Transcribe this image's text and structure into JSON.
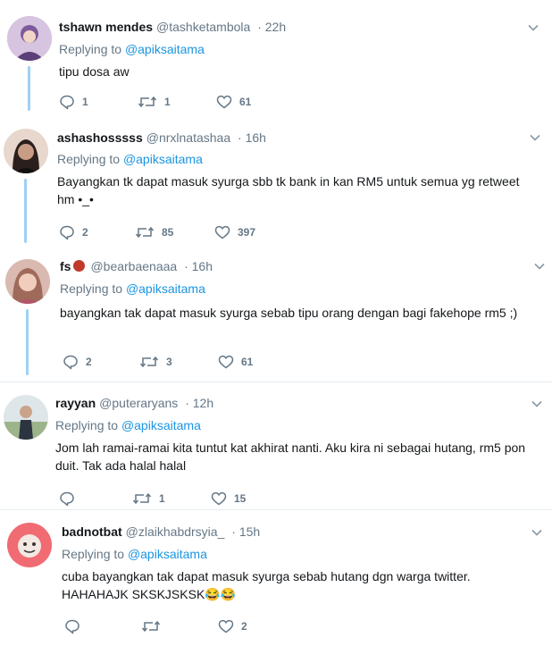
{
  "tweets": [
    {
      "name": "tshawn mendes",
      "handle": "@tashketambola",
      "time": "· 22h",
      "replying_prefix": "Replying to",
      "replying_to": "@apiksaitama",
      "text": "tipu dosa aw",
      "replies": "1",
      "retweets": "1",
      "likes": "61"
    },
    {
      "name": "ashashosssss",
      "handle": "@nrxlnatashaa",
      "time": "· 16h",
      "replying_prefix": "Replying to",
      "replying_to": "@apiksaitama",
      "text": "Bayangkan tk dapat masuk syurga sbb tk bank in kan RM5 untuk semua yg retweet hm •_•",
      "replies": "2",
      "retweets": "85",
      "likes": "397"
    },
    {
      "name": "fs",
      "handle": "@bearbaenaaa",
      "time": "· 16h",
      "replying_prefix": "Replying to",
      "replying_to": "@apiksaitama",
      "text": "bayangkan tak dapat masuk syurga sebab tipu orang dengan bagi fakehope rm5 ;)",
      "replies": "2",
      "retweets": "3",
      "likes": "61"
    },
    {
      "name": "rayyan",
      "handle": "@puteraryans",
      "time": "· 12h",
      "replying_prefix": "Replying to",
      "replying_to": "@apiksaitama",
      "text": "Jom lah ramai-ramai kita tuntut kat akhirat nanti. Aku kira ni sebagai hutang, rm5 pon duit. Tak ada halal halal",
      "replies": "",
      "retweets": "1",
      "likes": "15"
    },
    {
      "name": "badnotbat",
      "handle": "@zlaikhabdrsyia_",
      "time": "· 15h",
      "replying_prefix": "Replying to",
      "replying_to": "@apiksaitama",
      "text": "cuba bayangkan tak dapat masuk syurga sebab hutang dgn warga twitter. HAHAHAJK SKSKJSKSK😂😂",
      "replies": "",
      "retweets": "",
      "likes": "2"
    }
  ],
  "icons": {
    "reply": "reply-icon",
    "retweet": "retweet-icon",
    "like": "heart-icon",
    "more": "chevron-down-icon"
  },
  "colors": {
    "link": "#1b95e0",
    "muted": "#657786",
    "thread_line": "#9fd0f4",
    "divider": "#e6ecf0"
  }
}
